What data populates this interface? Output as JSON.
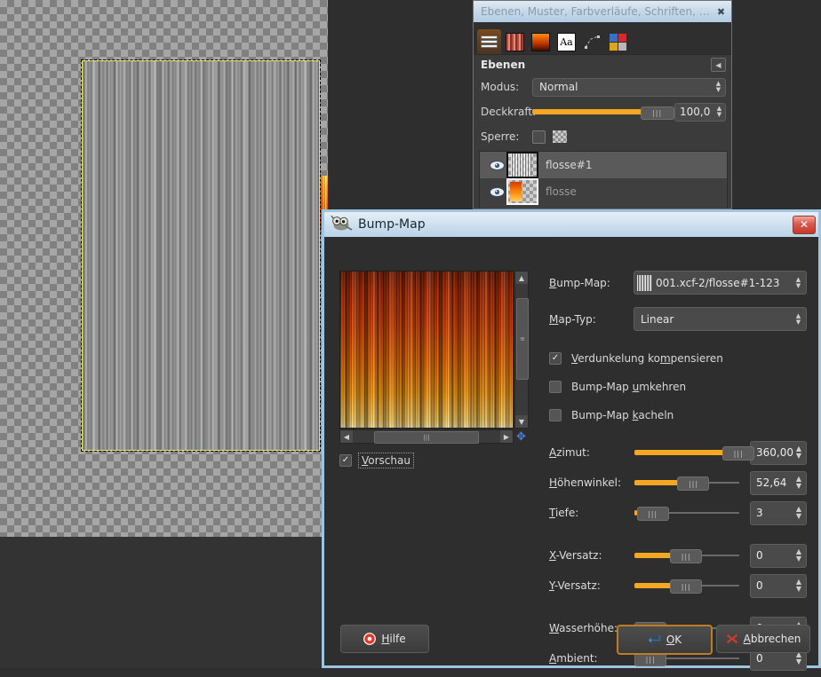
{
  "app": {
    "name": "GIMP"
  },
  "canvas": {
    "layer_name": "flosse#1",
    "selection_visible": "marching-ants-selection"
  },
  "layers_dock": {
    "title": "Ebenen, Muster, Farbverläufe, Schriften, Pf…",
    "close_icon": "✖",
    "tabs": [
      {
        "name": "layers-tab",
        "icon": "layers-icon",
        "active": true
      },
      {
        "name": "patterns-tab",
        "icon": "pattern-icon",
        "active": false
      },
      {
        "name": "gradients-tab",
        "icon": "gradient-icon",
        "active": false
      },
      {
        "name": "fonts-tab",
        "icon": "font-icon",
        "label": "Aa",
        "active": false
      },
      {
        "name": "paths-tab",
        "icon": "paths-icon",
        "active": false
      },
      {
        "name": "palettes-tab",
        "icon": "colors-icon",
        "active": false
      }
    ],
    "section_title": "Ebenen",
    "mode_label": "Modus:",
    "mode_value": "Normal",
    "opacity_label": "Deckkraft:",
    "opacity_value": "100,0",
    "lock_label": "Sperre:",
    "layers": [
      {
        "name": "flosse#1",
        "selected": true,
        "visible": true
      },
      {
        "name": "flosse",
        "selected": false,
        "visible": true
      }
    ]
  },
  "bumpmap_dialog": {
    "title": "Bump-Map",
    "close_icon": "✕",
    "preview_label": "Vorschau",
    "preview_checked": true,
    "fields": [
      {
        "label": "Bump-Map:",
        "value": "001.xcf-2/flosse#1-123",
        "has_thumb": true
      },
      {
        "label": "Map-Typ:",
        "value": "Linear",
        "has_thumb": false
      }
    ],
    "checkboxes": [
      {
        "label": "Verdunkelung kompensieren",
        "checked": true
      },
      {
        "label": "Bump-Map umkehren",
        "checked": false
      },
      {
        "label": "Bump-Map kacheln",
        "checked": false
      }
    ],
    "sliders": [
      {
        "label": "Azimut:",
        "value": "360,00",
        "fill_pct": 88,
        "knob_pct": 88
      },
      {
        "label": "Höhenwinkel:",
        "value": "52,64",
        "fill_pct": 45,
        "knob_pct": 45
      },
      {
        "label": "Tiefe:",
        "value": "3",
        "fill_pct": 2,
        "knob_pct": 2
      },
      {
        "label": "X-Versatz:",
        "value": "0",
        "fill_pct": 38,
        "knob_pct": 38
      },
      {
        "label": "Y-Versatz:",
        "value": "0",
        "fill_pct": 38,
        "knob_pct": 38
      },
      {
        "label": "Wasserhöhe:",
        "value": "0",
        "fill_pct": 0,
        "knob_pct": 0
      },
      {
        "label": "Ambient:",
        "value": "0",
        "fill_pct": 0,
        "knob_pct": 0
      }
    ],
    "buttons": {
      "help": "Hilfe",
      "ok": "OK",
      "cancel": "Abbrechen"
    }
  },
  "colors": {
    "accent_orange": "#f5a623",
    "titlebar_blue": "#b9d3e8",
    "dialog_bg": "#2e2e2e",
    "focus_border": "#c07c24",
    "cancel_x": "#d33a2c"
  }
}
